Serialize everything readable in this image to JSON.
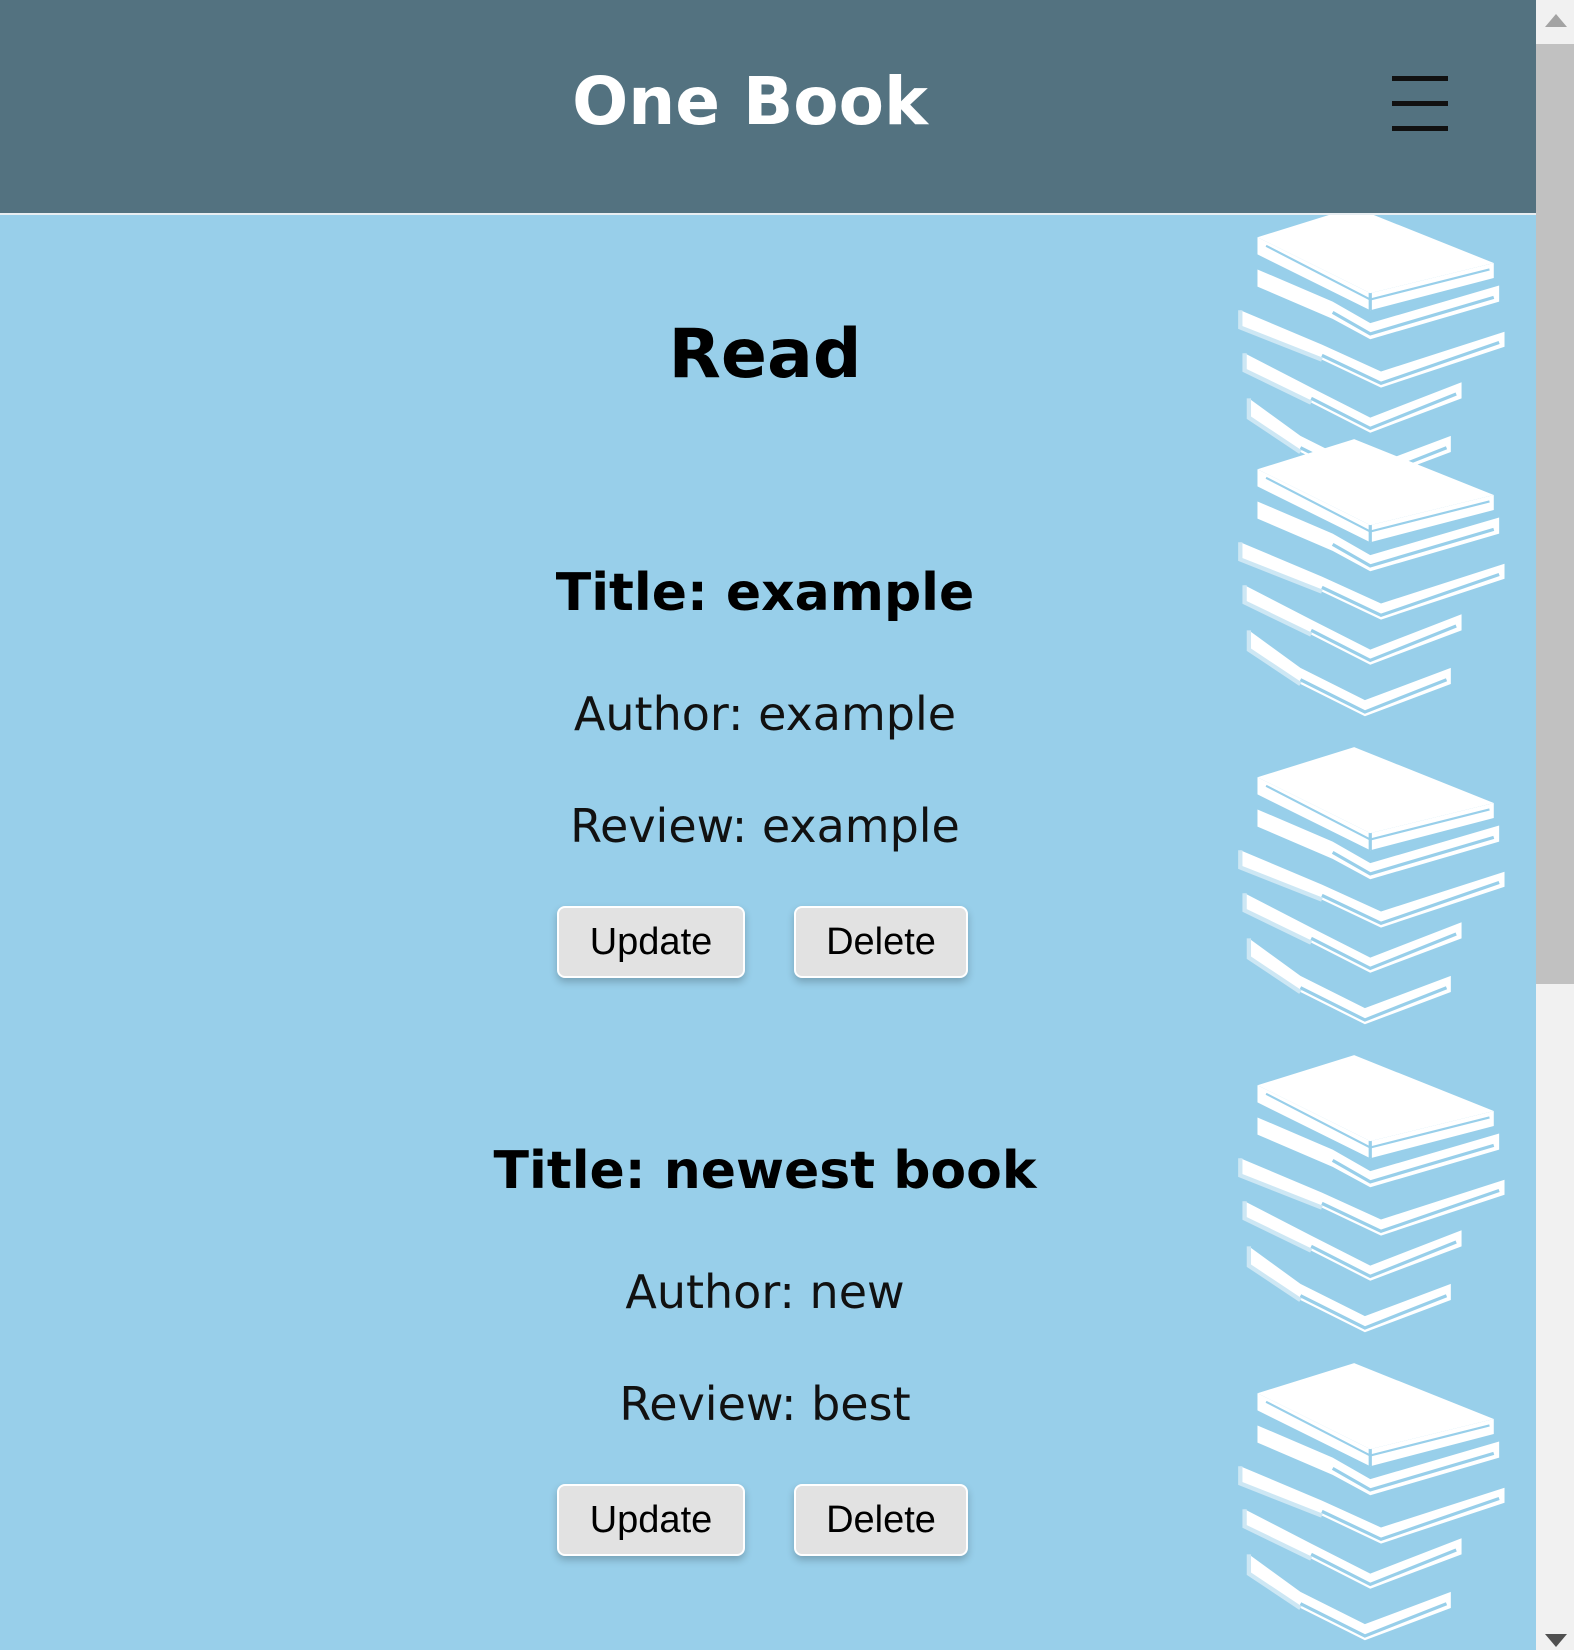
{
  "header": {
    "title": "One Book",
    "menu_icon": "hamburger-menu-icon"
  },
  "main": {
    "section_title": "Read",
    "decoration_icon": "book-stack-icon",
    "books": [
      {
        "title": "Title: example",
        "author": "Author: example",
        "review": "Review: example",
        "update_label": "Update",
        "delete_label": "Delete"
      },
      {
        "title": "Title: newest book",
        "author": "Author: new",
        "review": "Review: best",
        "update_label": "Update",
        "delete_label": "Delete"
      }
    ]
  },
  "colors": {
    "header_bg": "#537280",
    "page_bg": "#98cfea",
    "button_bg": "#e2e2e2"
  }
}
